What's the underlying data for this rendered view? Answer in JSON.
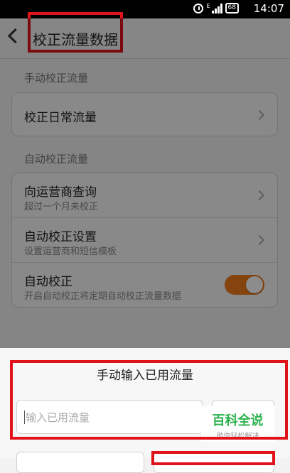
{
  "status_bar": {
    "time": "14:07",
    "battery": "68",
    "network": "E",
    "icons": [
      "alarm-icon",
      "signal-icon",
      "battery-icon"
    ]
  },
  "app_bar": {
    "title": "校正流量数据",
    "back_icon": "chevron-left-icon"
  },
  "manual_section": {
    "label": "手动校正流量",
    "items": [
      {
        "title": "校正日常流量"
      }
    ]
  },
  "auto_section": {
    "label": "自动校正流量",
    "items": [
      {
        "title": "向运营商查询",
        "subtitle": "超过一个月未校正"
      },
      {
        "title": "自动校正设置",
        "subtitle": "设置运营商和短信模板"
      },
      {
        "title": "自动校正",
        "subtitle": "开启自动校正将定期自动校正流量数据",
        "toggle_on": true
      }
    ]
  },
  "dialog": {
    "title": "手动输入已用流量",
    "input_placeholder": "输入已用流量",
    "input_value": ""
  },
  "watermark": {
    "main": "百科全说",
    "sub": "助你轻松解决"
  },
  "colors": {
    "accent": "#f27a1a",
    "highlight": "#e0121a",
    "watermark": "#2bb24c"
  }
}
